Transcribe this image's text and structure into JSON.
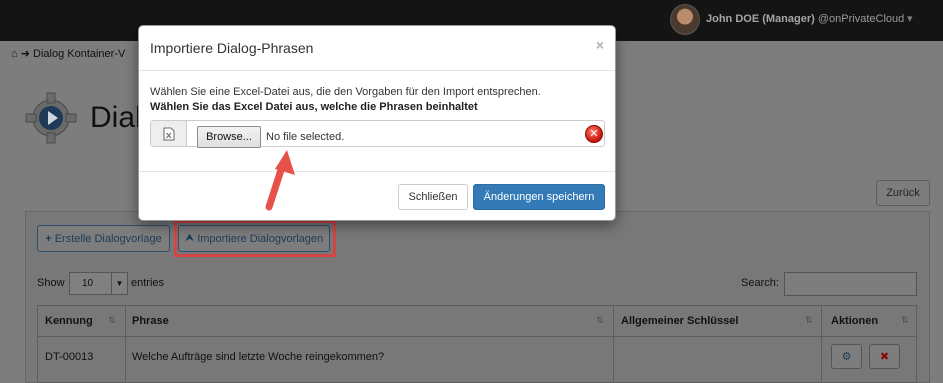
{
  "header": {
    "user_name": "John DOE (Manager)",
    "user_org": "@onPrivateCloud"
  },
  "breadcrumb": {
    "label": "Dialog Kontainer-V"
  },
  "page": {
    "title": "Dialo"
  },
  "buttons": {
    "back": "Zurück",
    "create_template": "Erstelle Dialogvorlage",
    "import_templates": "Importiere Dialogvorlagen"
  },
  "table_controls": {
    "show_label": "Show",
    "entries_value": "10",
    "entries_label": "entries",
    "search_label": "Search:"
  },
  "table": {
    "columns": [
      "Kennung",
      "Phrase",
      "Allgemeiner Schlüssel",
      "Aktionen"
    ],
    "rows": [
      {
        "kennung": "DT-00013",
        "phrase": "Welche Aufträge sind letzte Woche reingekommen?",
        "key": ""
      }
    ]
  },
  "modal": {
    "title": "Importiere Dialog-Phrasen",
    "close_symbol": "×",
    "description": "Wählen Sie eine Excel-Datei aus, die den Vorgaben für den Import entsprechen.",
    "description_bold": "Wählen Sie das Excel Datei aus, welche die Phrasen beinhaltet",
    "browse_label": "Browse...",
    "file_status": "No file selected.",
    "cancel_label": "Schließen",
    "save_label": "Änderungen speichern"
  },
  "colors": {
    "primary": "#337ab7",
    "highlight": "#d64545",
    "arrow": "#e8504a",
    "danger": "#c4140a"
  }
}
